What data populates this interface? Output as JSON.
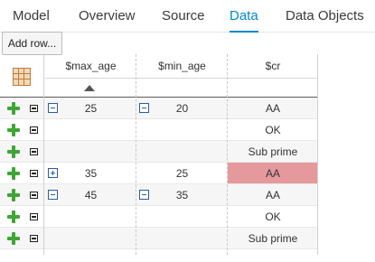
{
  "tabs": [
    {
      "label": "Model",
      "active": false
    },
    {
      "label": "Overview",
      "active": false
    },
    {
      "label": "Source",
      "active": false
    },
    {
      "label": "Data",
      "active": true
    },
    {
      "label": "Data Objects",
      "active": false
    }
  ],
  "toolbar": {
    "add_row_label": "Add row..."
  },
  "table": {
    "columns": [
      "$max_age",
      "$min_age",
      "$cr"
    ],
    "rows": [
      {
        "max_age": "25",
        "min_age": "20",
        "cr": "AA",
        "max_toggle": "collapse",
        "min_toggle": "collapse",
        "highlight": false
      },
      {
        "max_age": "",
        "min_age": "",
        "cr": "OK",
        "highlight": false
      },
      {
        "max_age": "",
        "min_age": "",
        "cr": "Sub prime",
        "highlight": false
      },
      {
        "max_age": "35",
        "min_age": "25",
        "cr": "AA",
        "max_toggle": "expand",
        "min_toggle": "",
        "highlight": true
      },
      {
        "max_age": "45",
        "min_age": "35",
        "cr": "AA",
        "max_toggle": "collapse",
        "min_toggle": "collapse",
        "highlight": false
      },
      {
        "max_age": "",
        "min_age": "",
        "cr": "OK",
        "highlight": false
      },
      {
        "max_age": "",
        "min_age": "",
        "cr": "Sub prime",
        "highlight": false
      }
    ]
  },
  "colors": {
    "active_tab": "#0088ce",
    "highlight": "#e5999c",
    "add_icon": "#3fa535"
  },
  "icons": {
    "corner": "grid-select-icon",
    "sort": "sort-ascending-icon"
  }
}
